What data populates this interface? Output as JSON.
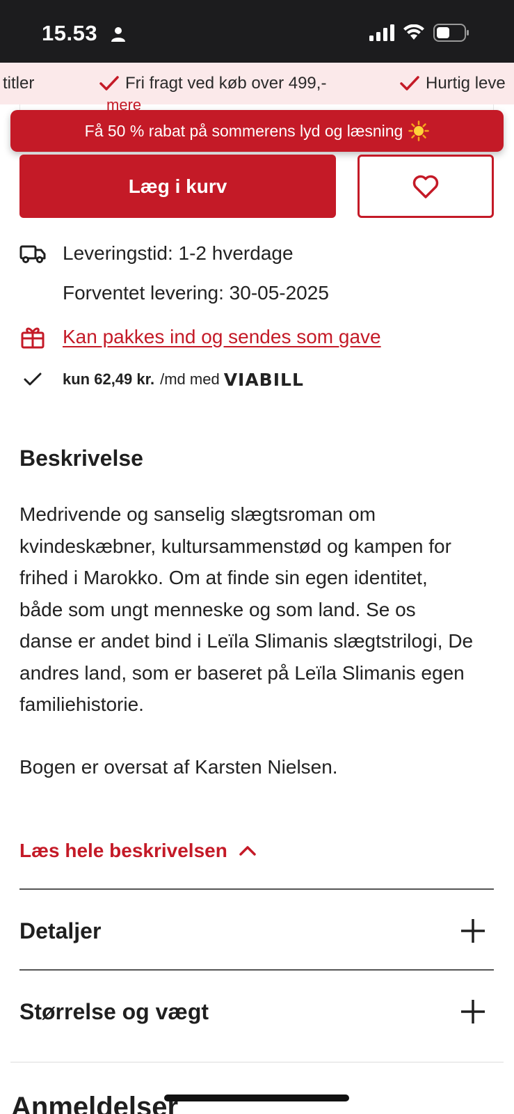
{
  "status_bar": {
    "time": "15.53"
  },
  "usp": {
    "items": [
      "titler",
      "Fri fragt ved køb over 499,-",
      "Hurtig leve"
    ]
  },
  "card": {
    "more_text": "mere"
  },
  "promo": {
    "text": "Få 50 % rabat på sommerens lyd og læsning"
  },
  "actions": {
    "add_to_cart": "Læg i kurv"
  },
  "delivery": {
    "time": "Leveringstid: 1-2 hverdage",
    "expected": "Forventet levering: 30-05-2025",
    "gift": "Kan pakkes ind og sendes som gave",
    "viabill_price": "kun 62,49 kr.",
    "viabill_suffix": "/md med",
    "viabill_logo": "VIABILL"
  },
  "description": {
    "title": "Beskrivelse",
    "lines": [
      "Medrivende og sanselig slægtsroman om",
      "kvindeskæbner, kultursammenstød og kampen for",
      "frihed i Marokko. Om at finde sin egen identitet,",
      "både som ungt menneske og som land. Se os",
      "danse er andet bind i Leïla Slimanis slægtstrilogi, De",
      "andres land, som er baseret på Leïla Slimanis egen",
      "familiehistorie."
    ],
    "translator": "Bogen er oversat af Karsten Nielsen.",
    "read_more": "Læs hele beskrivelsen"
  },
  "accordions": [
    {
      "title": "Detaljer"
    },
    {
      "title": "Størrelse og vægt"
    }
  ],
  "reviews": {
    "title": "Anmeldelser"
  },
  "colors": {
    "brand_red": "#c41a27",
    "usp_background": "#fbe9ea",
    "status_bar": "#1c1c1e"
  }
}
